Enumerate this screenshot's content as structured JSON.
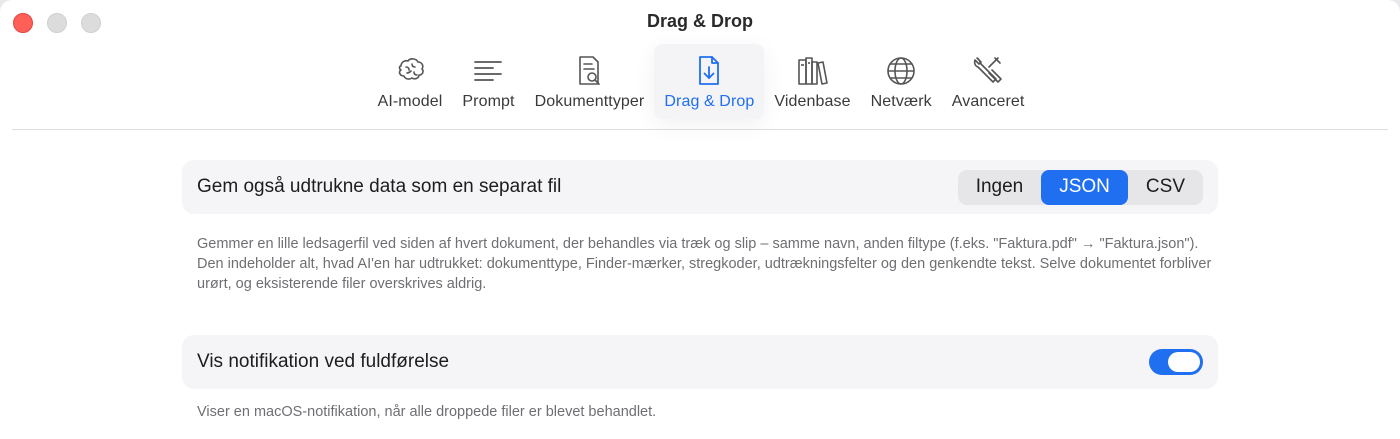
{
  "window": {
    "title": "Drag & Drop"
  },
  "toolbar": {
    "tabs": [
      {
        "label": "AI-model",
        "icon": "brain-icon"
      },
      {
        "label": "Prompt",
        "icon": "text-lines-icon"
      },
      {
        "label": "Dokumenttyper",
        "icon": "document-search-icon"
      },
      {
        "label": "Drag & Drop",
        "icon": "document-download-icon",
        "active": true
      },
      {
        "label": "Videnbase",
        "icon": "books-icon"
      },
      {
        "label": "Netværk",
        "icon": "globe-icon"
      },
      {
        "label": "Avanceret",
        "icon": "tools-icon"
      }
    ]
  },
  "settings": {
    "save_file": {
      "label": "Gem også udtrukne data som en separat fil",
      "options": [
        "Ingen",
        "JSON",
        "CSV"
      ],
      "selected": "JSON",
      "description": "Gemmer en lille ledsagerfil ved siden af hvert dokument, der behandles via træk og slip – samme navn, anden filtype (f.eks. \"Faktura.pdf\" → \"Faktura.json\"). Den indeholder alt, hvad AI'en har udtrukket: dokumenttype, Finder-mærker, stregkoder, udtrækningsfelter og den genkendte tekst. Selve dokumentet forbliver urørt, og eksisterende filer overskrives aldrig."
    },
    "notification": {
      "label": "Vis notifikation ved fuldførelse",
      "enabled": true,
      "description": "Viser en macOS-notifikation, når alle droppede filer er blevet behandlet."
    }
  },
  "colors": {
    "accent": "#1f6ff0",
    "close": "#fe5f57"
  }
}
